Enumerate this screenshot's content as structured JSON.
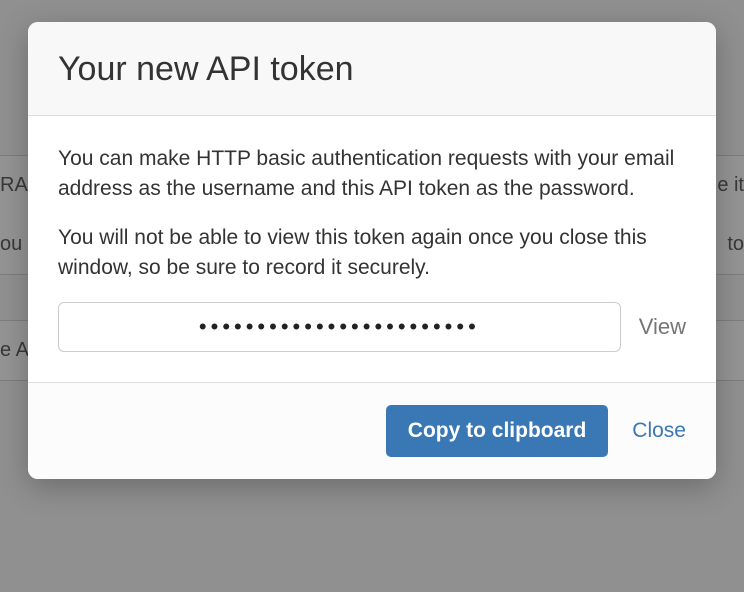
{
  "modal": {
    "title": "Your new API token",
    "paragraph1": "You can make HTTP basic authentication requests with your email address as the username and this API token as the password.",
    "paragraph2": "You will not be able to view this token again once you close this window, so be sure to record it securely.",
    "tokenMasked": "••••••••••••••••••••••••",
    "viewLabel": "View",
    "copyLabel": "Copy to clipboard",
    "closeLabel": "Close"
  },
  "background": {
    "row1Left": "RA",
    "row1Right": "e it",
    "row1bLeft": "ou",
    "row1bRight": "to",
    "row2Left": "e A"
  },
  "colors": {
    "primary": "#3a78b5",
    "text": "#333333",
    "muted": "#757575",
    "border": "#dddddd"
  }
}
